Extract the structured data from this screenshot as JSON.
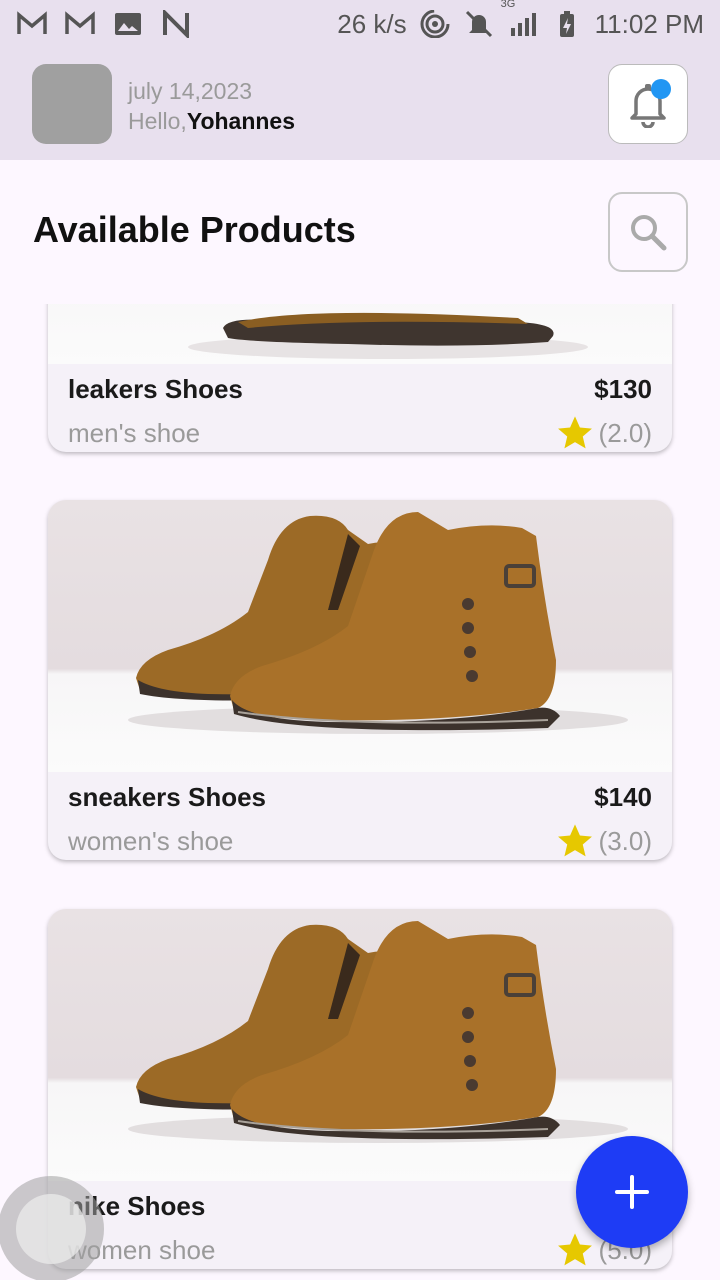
{
  "status_bar": {
    "left_icons": [
      "gmail-icon",
      "gmail-icon",
      "gallery-icon",
      "n-app-icon"
    ],
    "speed": "26 k/s",
    "network_label": "3G",
    "time": "11:02 PM"
  },
  "header": {
    "date": "july 14,2023",
    "greeting_prefix": "Hello,",
    "user_name": "Yohannes",
    "notification_color": "#2196f3"
  },
  "main": {
    "title": "Available Products"
  },
  "products": [
    {
      "name": "leakers Shoes",
      "price": "$130",
      "category": "men's shoe",
      "rating": "(2.0)"
    },
    {
      "name": "sneakers Shoes",
      "price": "$140",
      "category": "women's shoe",
      "rating": "(3.0)"
    },
    {
      "name": "nike Shoes",
      "price": "",
      "category": "women shoe",
      "rating": "(5.0)"
    }
  ],
  "colors": {
    "accent": "#1e3cf5",
    "star": "#e6c800",
    "header_bg": "#e8e0ee"
  },
  "fab": {
    "icon": "plus-icon"
  }
}
